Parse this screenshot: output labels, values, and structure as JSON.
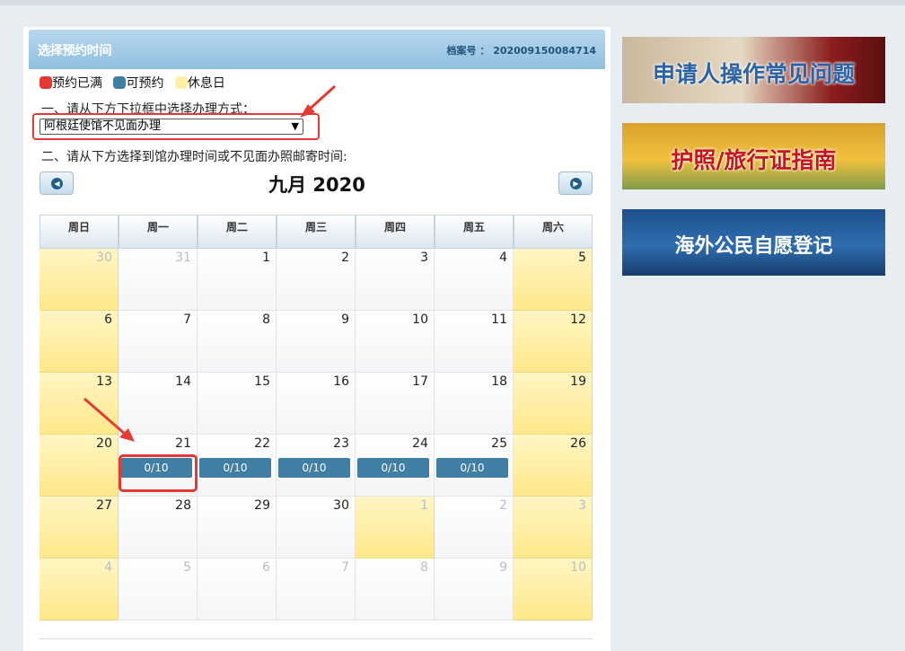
{
  "panel": {
    "title": "选择预约时间",
    "file_no_label": "档案号 ： 202009150084714"
  },
  "legend": {
    "full_label": "预约已满",
    "available_label": "可预约",
    "holiday_label": "休息日",
    "full_color": "#e53935",
    "available_color": "#3f7fa3",
    "holiday_color": "#fff0a8"
  },
  "step1": {
    "instruction": "一、请从下方下拉框中选择办理方式：",
    "select_value": "阿根廷使馆不见面办理"
  },
  "step2": {
    "instruction": "二、请从下方选择到馆办理时间或不见面办照邮寄时间:"
  },
  "calendar": {
    "month_title": "九月 2020",
    "weekdays": [
      "周日",
      "周一",
      "周二",
      "周三",
      "周四",
      "周五",
      "周六"
    ],
    "weeks": [
      [
        {
          "d": "30",
          "o": true,
          "w": true
        },
        {
          "d": "31",
          "o": true
        },
        {
          "d": "1"
        },
        {
          "d": "2"
        },
        {
          "d": "3"
        },
        {
          "d": "4"
        },
        {
          "d": "5",
          "w": true
        }
      ],
      [
        {
          "d": "6",
          "w": true
        },
        {
          "d": "7"
        },
        {
          "d": "8"
        },
        {
          "d": "9"
        },
        {
          "d": "10"
        },
        {
          "d": "11"
        },
        {
          "d": "12",
          "w": true
        }
      ],
      [
        {
          "d": "13",
          "w": true
        },
        {
          "d": "14"
        },
        {
          "d": "15"
        },
        {
          "d": "16"
        },
        {
          "d": "17"
        },
        {
          "d": "18"
        },
        {
          "d": "19",
          "w": true
        }
      ],
      [
        {
          "d": "20",
          "w": true
        },
        {
          "d": "21",
          "s": "0/10"
        },
        {
          "d": "22",
          "s": "0/10"
        },
        {
          "d": "23",
          "s": "0/10"
        },
        {
          "d": "24",
          "s": "0/10"
        },
        {
          "d": "25",
          "s": "0/10"
        },
        {
          "d": "26",
          "w": true
        }
      ],
      [
        {
          "d": "27",
          "w": true
        },
        {
          "d": "28"
        },
        {
          "d": "29"
        },
        {
          "d": "30"
        },
        {
          "d": "1",
          "o": true,
          "h": true
        },
        {
          "d": "2",
          "o": true
        },
        {
          "d": "3",
          "o": true,
          "w": true
        }
      ],
      [
        {
          "d": "4",
          "o": true,
          "w": true
        },
        {
          "d": "5",
          "o": true
        },
        {
          "d": "6",
          "o": true
        },
        {
          "d": "7",
          "o": true
        },
        {
          "d": "8",
          "o": true
        },
        {
          "d": "9",
          "o": true
        },
        {
          "d": "10",
          "o": true,
          "w": true
        }
      ]
    ]
  },
  "banners": {
    "faq": "申请人操作常见问题",
    "passport_guide": "护照/旅行证指南",
    "overseas_registration": "海外公民自愿登记"
  }
}
